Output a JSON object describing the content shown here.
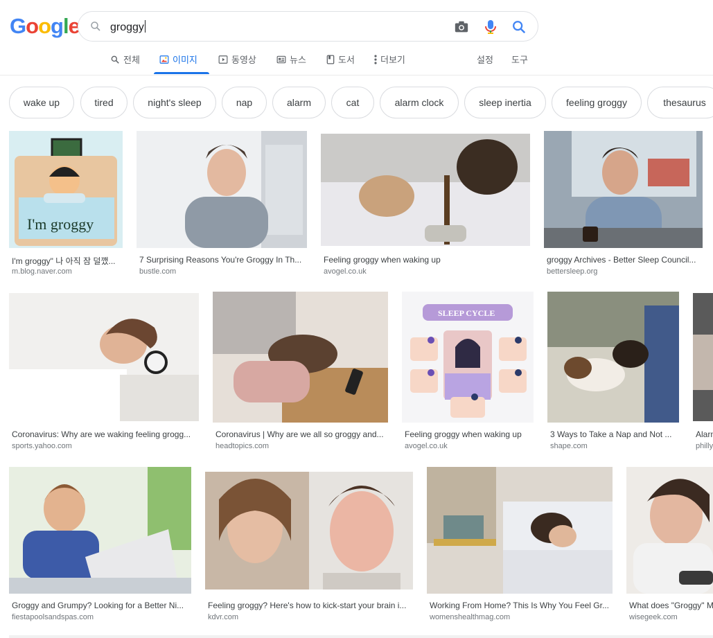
{
  "logo": {
    "letters": [
      "G",
      "o",
      "o",
      "g",
      "l",
      "e"
    ],
    "colors": [
      "#4285f4",
      "#ea4335",
      "#fbbc05",
      "#4285f4",
      "#34a853",
      "#ea4335"
    ]
  },
  "search": {
    "query": "groggy"
  },
  "tabs": {
    "all": "전체",
    "images": "이미지",
    "videos": "동영상",
    "news": "뉴스",
    "books": "도서",
    "more": "더보기",
    "settings": "설정",
    "tools": "도구"
  },
  "chips": [
    "wake up",
    "tired",
    "night's sleep",
    "nap",
    "alarm",
    "cat",
    "alarm clock",
    "sleep inertia",
    "feeling groggy",
    "thesaurus"
  ],
  "results": [
    {
      "title": "I'm groggy\" 나 아직 잠 덜깼...",
      "source": "m.blog.naver.com",
      "thumb_text": "I'm groggy"
    },
    {
      "title": "7 Surprising Reasons You're Groggy In Th...",
      "source": "bustle.com"
    },
    {
      "title": "Feeling groggy when waking up",
      "source": "avogel.co.uk"
    },
    {
      "title": "groggy Archives - Better Sleep Council...",
      "source": "bettersleep.org"
    },
    {
      "title": "Coronavirus: Why are we waking feeling grogg...",
      "source": "sports.yahoo.com"
    },
    {
      "title": "Coronavirus | Why are we all so groggy and...",
      "source": "headtopics.com"
    },
    {
      "title": "Feeling groggy when waking up",
      "source": "avogel.co.uk",
      "thumb_text": "SLEEP CYCLE"
    },
    {
      "title": "3 Ways to Take a Nap and Not ...",
      "source": "shape.com"
    },
    {
      "title": "Alarm",
      "source": "philly"
    },
    {
      "title": "Groggy and Grumpy? Looking for a Better Ni...",
      "source": "fiestapoolsandspas.com"
    },
    {
      "title": "Feeling groggy? Here's how to kick-start your brain i...",
      "source": "kdvr.com"
    },
    {
      "title": "Working From Home? This Is Why You Feel Gr...",
      "source": "womenshealthmag.com"
    },
    {
      "title": "What does \"Groggy\" M",
      "source": "wisegeek.com"
    }
  ],
  "colors": {
    "accent": "#1a73e8",
    "chip_border": "#dadce0",
    "muted": "#70757a"
  }
}
